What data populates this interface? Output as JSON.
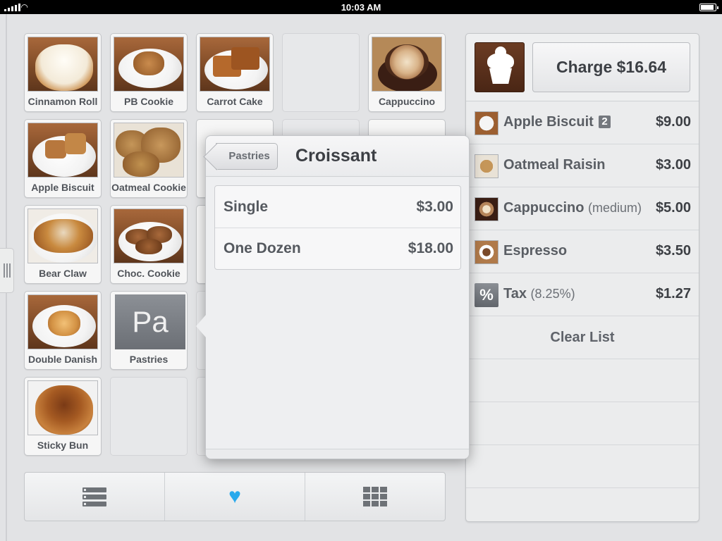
{
  "status_bar": {
    "time": "10:03 AM"
  },
  "products": [
    {
      "label": "Cinnamon Roll",
      "image": "cinnamon-roll"
    },
    {
      "label": "PB Cookie",
      "image": "pb-cookie"
    },
    {
      "label": "Carrot Cake",
      "image": "carrot-cake"
    },
    {
      "label": "Cappuccino",
      "image": "cappuccino"
    },
    {
      "label": "Apple Biscuit",
      "image": "apple-biscuit"
    },
    {
      "label": "Oatmeal Cookie",
      "image": "oatmeal-cookie"
    },
    {
      "label": "Bear Claw",
      "image": "bear-claw"
    },
    {
      "label": "Choc. Cookie",
      "image": "choc-cookie"
    },
    {
      "label": "Double Danish",
      "image": "double-danish"
    },
    {
      "label": "Pastries",
      "icon_text": "Pa"
    },
    {
      "label": "Sticky Bun",
      "image": "sticky-bun"
    }
  ],
  "popover": {
    "back_label": "Pastries",
    "title": "Croissant",
    "variants": [
      {
        "name": "Single",
        "price": "$3.00"
      },
      {
        "name": "One Dozen",
        "price": "$18.00"
      }
    ]
  },
  "toolbar": {
    "buttons": [
      {
        "icon": "list-icon"
      },
      {
        "icon": "heart-icon",
        "color": "#29a9ec"
      },
      {
        "icon": "grid-icon"
      }
    ]
  },
  "cart": {
    "charge_label": "Charge $16.64",
    "items": [
      {
        "name": "Apple Biscuit",
        "qty": "2",
        "modifier": "",
        "price": "$9.00",
        "image": "apple-biscuit"
      },
      {
        "name": "Oatmeal Raisin",
        "qty": "",
        "modifier": "",
        "price": "$3.00",
        "image": "oatmeal-cookie"
      },
      {
        "name": "Cappuccino",
        "qty": "",
        "modifier": "(medium)",
        "price": "$5.00",
        "image": "cappuccino"
      },
      {
        "name": "Espresso",
        "qty": "",
        "modifier": "",
        "price": "$3.50",
        "image": "espresso"
      }
    ],
    "tax": {
      "icon_text": "%",
      "name": "Tax",
      "modifier": "(8.25%)",
      "price": "$1.27"
    },
    "clear_label": "Clear List"
  }
}
